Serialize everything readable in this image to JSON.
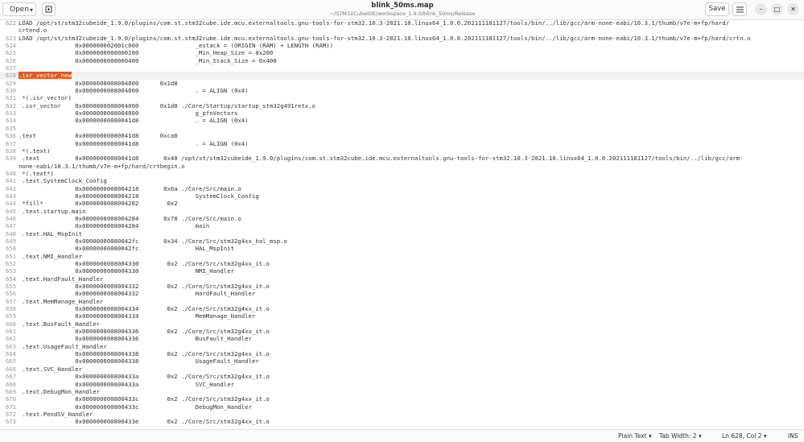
{
  "header": {
    "open_label": "Open",
    "title": "blink_50ms.map",
    "subtitle": "~/STM32CubeIDE/workspace_1.9.0/blink_50ms/Release",
    "save_label": "Save"
  },
  "editor": {
    "highlight_text": ".isr_vector_new",
    "lines": [
      {
        "n": "622",
        "t": "LOAD /opt/st/stm32cubeide_1.9.0/plugins/com.st.stm32cube.ide.mcu.externaltools.gnu-tools-for-stm32.10.3-2021.10.linux64_1.0.0.202111181127/tools/bin/../lib/gcc/arm-none-eabi/10.3.1/thumb/v7e-m+fp/hard/"
      },
      {
        "n": "",
        "t": "crtend.o"
      },
      {
        "n": "623",
        "t": "LOAD /opt/st/stm32cubeide_1.9.0/plugins/com.st.stm32cube.ide.mcu.externaltools.gnu-tools-for-stm32.10.3-2021.10.linux64_1.0.0.202111181127/tools/bin/../lib/gcc/arm-none-eabi/10.3.1/thumb/v7e-m+fp/hard/crtn.o"
      },
      {
        "n": "624",
        "t": "                0x000000002001c000                _estack = (ORIGIN (RAM) + LENGTH (RAM))"
      },
      {
        "n": "625",
        "t": "                0x0000000000000200                _Min_Heap_Size = 0x200"
      },
      {
        "n": "626",
        "t": "                0x0000000000000400                _Min_Stack_Size = 0x400"
      },
      {
        "n": "627",
        "t": ""
      },
      {
        "n": "628",
        "t": "",
        "current": true
      },
      {
        "n": "629",
        "t": "                0x0000000008004000      0x1d8"
      },
      {
        "n": "630",
        "t": "                0x0000000008004000                . = ALIGN (0x4)"
      },
      {
        "n": "631",
        "t": " *(.isr_vector)"
      },
      {
        "n": "632",
        "t": " .isr_vector    0x0000000008004000      0x1d8 ./Core/Startup/startup_stm32g491retx.o"
      },
      {
        "n": "633",
        "t": "                0x0000000008004000                g_pfnVectors"
      },
      {
        "n": "634",
        "t": "                0x00000000080041d8                . = ALIGN (0x4)"
      },
      {
        "n": "635",
        "t": ""
      },
      {
        "n": "636",
        "t": ".text           0x00000000080041d8      0xca0"
      },
      {
        "n": "637",
        "t": "                0x00000000080041d8                . = ALIGN (0x4)"
      },
      {
        "n": "638",
        "t": " *(.text)"
      },
      {
        "n": "639",
        "t": " .text          0x00000000080041d8       0x40 /opt/st/stm32cubeide_1.9.0/plugins/com.st.stm32cube.ide.mcu.externaltools.gnu-tools-for-stm32.10.3-2021.10.linux64_1.0.0.202111181127/tools/bin/../lib/gcc/arm-"
      },
      {
        "n": "",
        "t": "none-eabi/10.3.1/thumb/v7e-m+fp/hard/crtbegin.o"
      },
      {
        "n": "640",
        "t": " *(.text*)"
      },
      {
        "n": "641",
        "t": " .text.SystemClock_Config"
      },
      {
        "n": "642",
        "t": "                0x0000000008004218       0x6a ./Core/Src/main.o"
      },
      {
        "n": "643",
        "t": "                0x0000000008004218                SystemClock_Config"
      },
      {
        "n": "644",
        "t": " *fill*         0x0000000008004282        0x2"
      },
      {
        "n": "645",
        "t": " .text.startup.main"
      },
      {
        "n": "646",
        "t": "                0x0000000008004284       0x78 ./Core/Src/main.o"
      },
      {
        "n": "647",
        "t": "                0x0000000008004284                main"
      },
      {
        "n": "648",
        "t": " .text.HAL_MspInit"
      },
      {
        "n": "649",
        "t": "                0x00000000080042fc       0x34 ./Core/Src/stm32g4xx_hal_msp.o"
      },
      {
        "n": "650",
        "t": "                0x00000000080042fc                HAL_MspInit"
      },
      {
        "n": "651",
        "t": " .text.NMI_Handler"
      },
      {
        "n": "652",
        "t": "                0x0000000008004330        0x2 ./Core/Src/stm32g4xx_it.o"
      },
      {
        "n": "653",
        "t": "                0x0000000008004330                NMI_Handler"
      },
      {
        "n": "654",
        "t": " .text.HardFault_Handler"
      },
      {
        "n": "655",
        "t": "                0x0000000008004332        0x2 ./Core/Src/stm32g4xx_it.o"
      },
      {
        "n": "656",
        "t": "                0x0000000008004332                HardFault_Handler"
      },
      {
        "n": "657",
        "t": " .text.MemManage_Handler"
      },
      {
        "n": "658",
        "t": "                0x0000000008004334        0x2 ./Core/Src/stm32g4xx_it.o"
      },
      {
        "n": "659",
        "t": "                0x0000000008004334                MemManage_Handler"
      },
      {
        "n": "660",
        "t": " .text.BusFault_Handler"
      },
      {
        "n": "661",
        "t": "                0x0000000008004336        0x2 ./Core/Src/stm32g4xx_it.o"
      },
      {
        "n": "662",
        "t": "                0x0000000008004336                BusFault_Handler"
      },
      {
        "n": "663",
        "t": " .text.UsageFault_Handler"
      },
      {
        "n": "664",
        "t": "                0x0000000008004338        0x2 ./Core/Src/stm32g4xx_it.o"
      },
      {
        "n": "665",
        "t": "                0x0000000008004338                UsageFault_Handler"
      },
      {
        "n": "666",
        "t": " .text.SVC_Handler"
      },
      {
        "n": "667",
        "t": "                0x000000000800433a        0x2 ./Core/Src/stm32g4xx_it.o"
      },
      {
        "n": "668",
        "t": "                0x000000000800433a                SVC_Handler"
      },
      {
        "n": "669",
        "t": " .text.DebugMon_Handler"
      },
      {
        "n": "670",
        "t": "                0x000000000800433c        0x2 ./Core/Src/stm32g4xx_it.o"
      },
      {
        "n": "671",
        "t": "                0x000000000800433c                DebugMon_Handler"
      },
      {
        "n": "672",
        "t": " .text.PendSV_Handler"
      },
      {
        "n": "673",
        "t": "                0x000000000800433e        0x2 ./Core/Src/stm32g4xx_it.o"
      }
    ]
  },
  "status": {
    "language": "Plain Text",
    "tab_width": "Tab Width: 2",
    "position": "Ln 628, Col 2",
    "mode": "INS"
  },
  "colors": {
    "selection": "#e25a1b",
    "current_line": "#f2f2f2"
  },
  "icons": [
    "chevron-down-icon",
    "new-tab-icon",
    "hamburger-menu-icon",
    "minimize-icon",
    "maximize-icon",
    "close-icon"
  ]
}
